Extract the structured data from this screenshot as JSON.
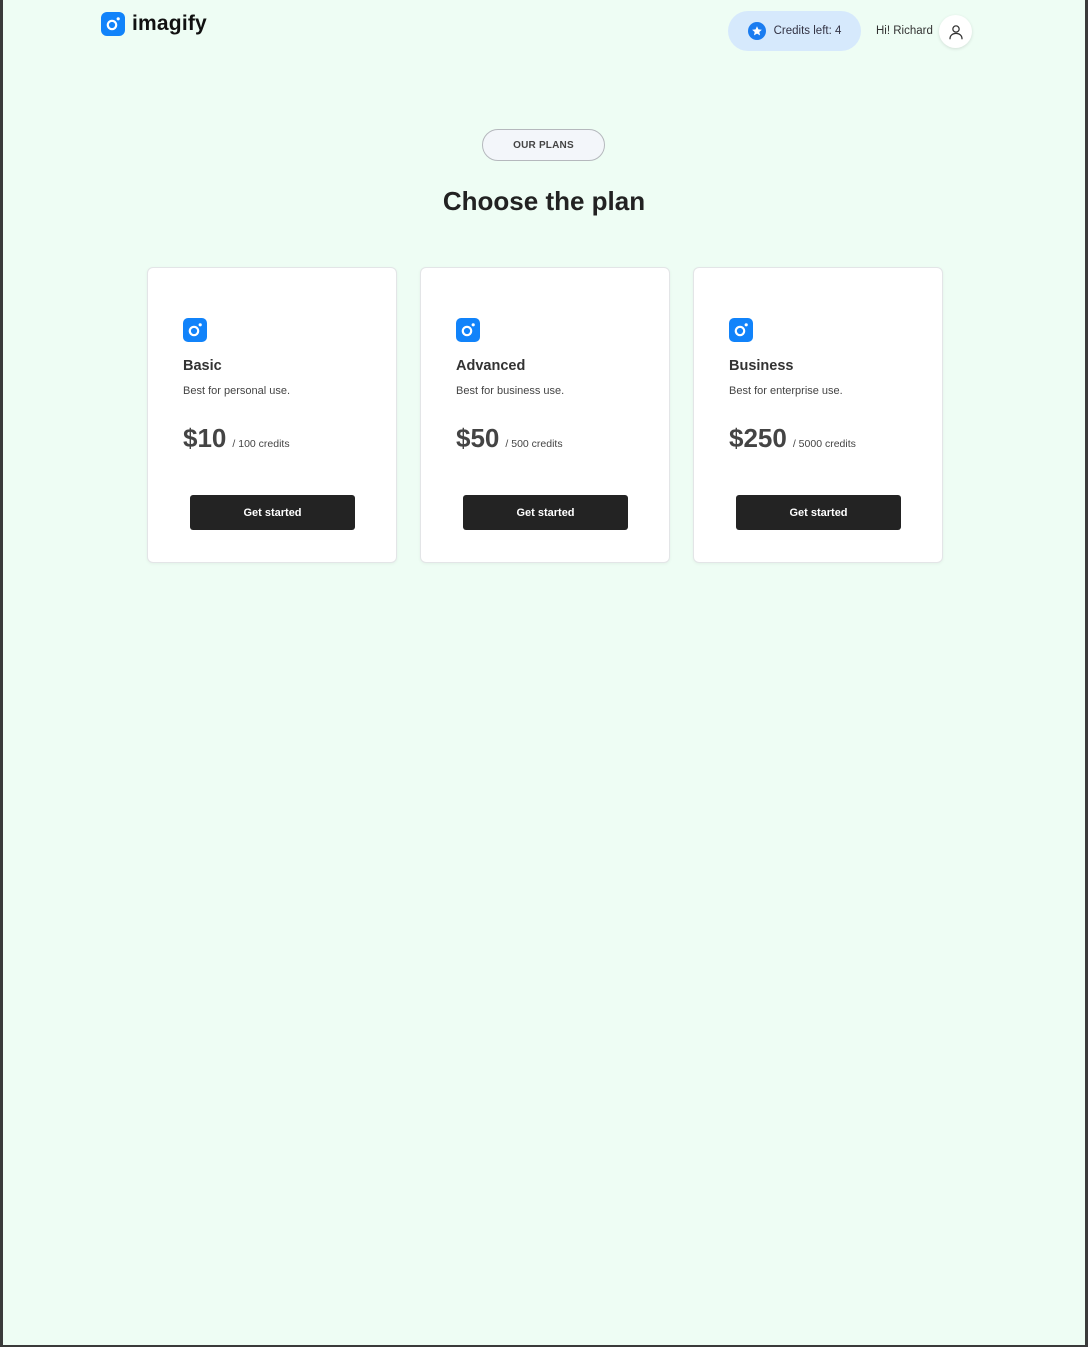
{
  "header": {
    "brand": "imagify",
    "credits_label": "Credits left: 4",
    "greeting": "Hi! Richard"
  },
  "hero": {
    "eyebrow": "OUR PLANS",
    "title": "Choose the plan"
  },
  "plans": [
    {
      "name": "Basic",
      "description": "Best for personal use.",
      "price": "$10",
      "credits": "/ 100 credits",
      "cta": "Get started"
    },
    {
      "name": "Advanced",
      "description": "Best for business use.",
      "price": "$50",
      "credits": "/ 500 credits",
      "cta": "Get started"
    },
    {
      "name": "Business",
      "description": "Best for enterprise use.",
      "price": "$250",
      "credits": "/ 5000 credits",
      "cta": "Get started"
    }
  ],
  "colors": {
    "page_background": "#eefdf4",
    "brand_blue": "#1183fa",
    "credits_pill": "#d6e9fc",
    "button_dark": "#232323"
  },
  "icons": {
    "brand": "lens-logo-icon",
    "credits": "star-badge-icon",
    "user": "user-icon",
    "plan": "lens-logo-icon"
  }
}
